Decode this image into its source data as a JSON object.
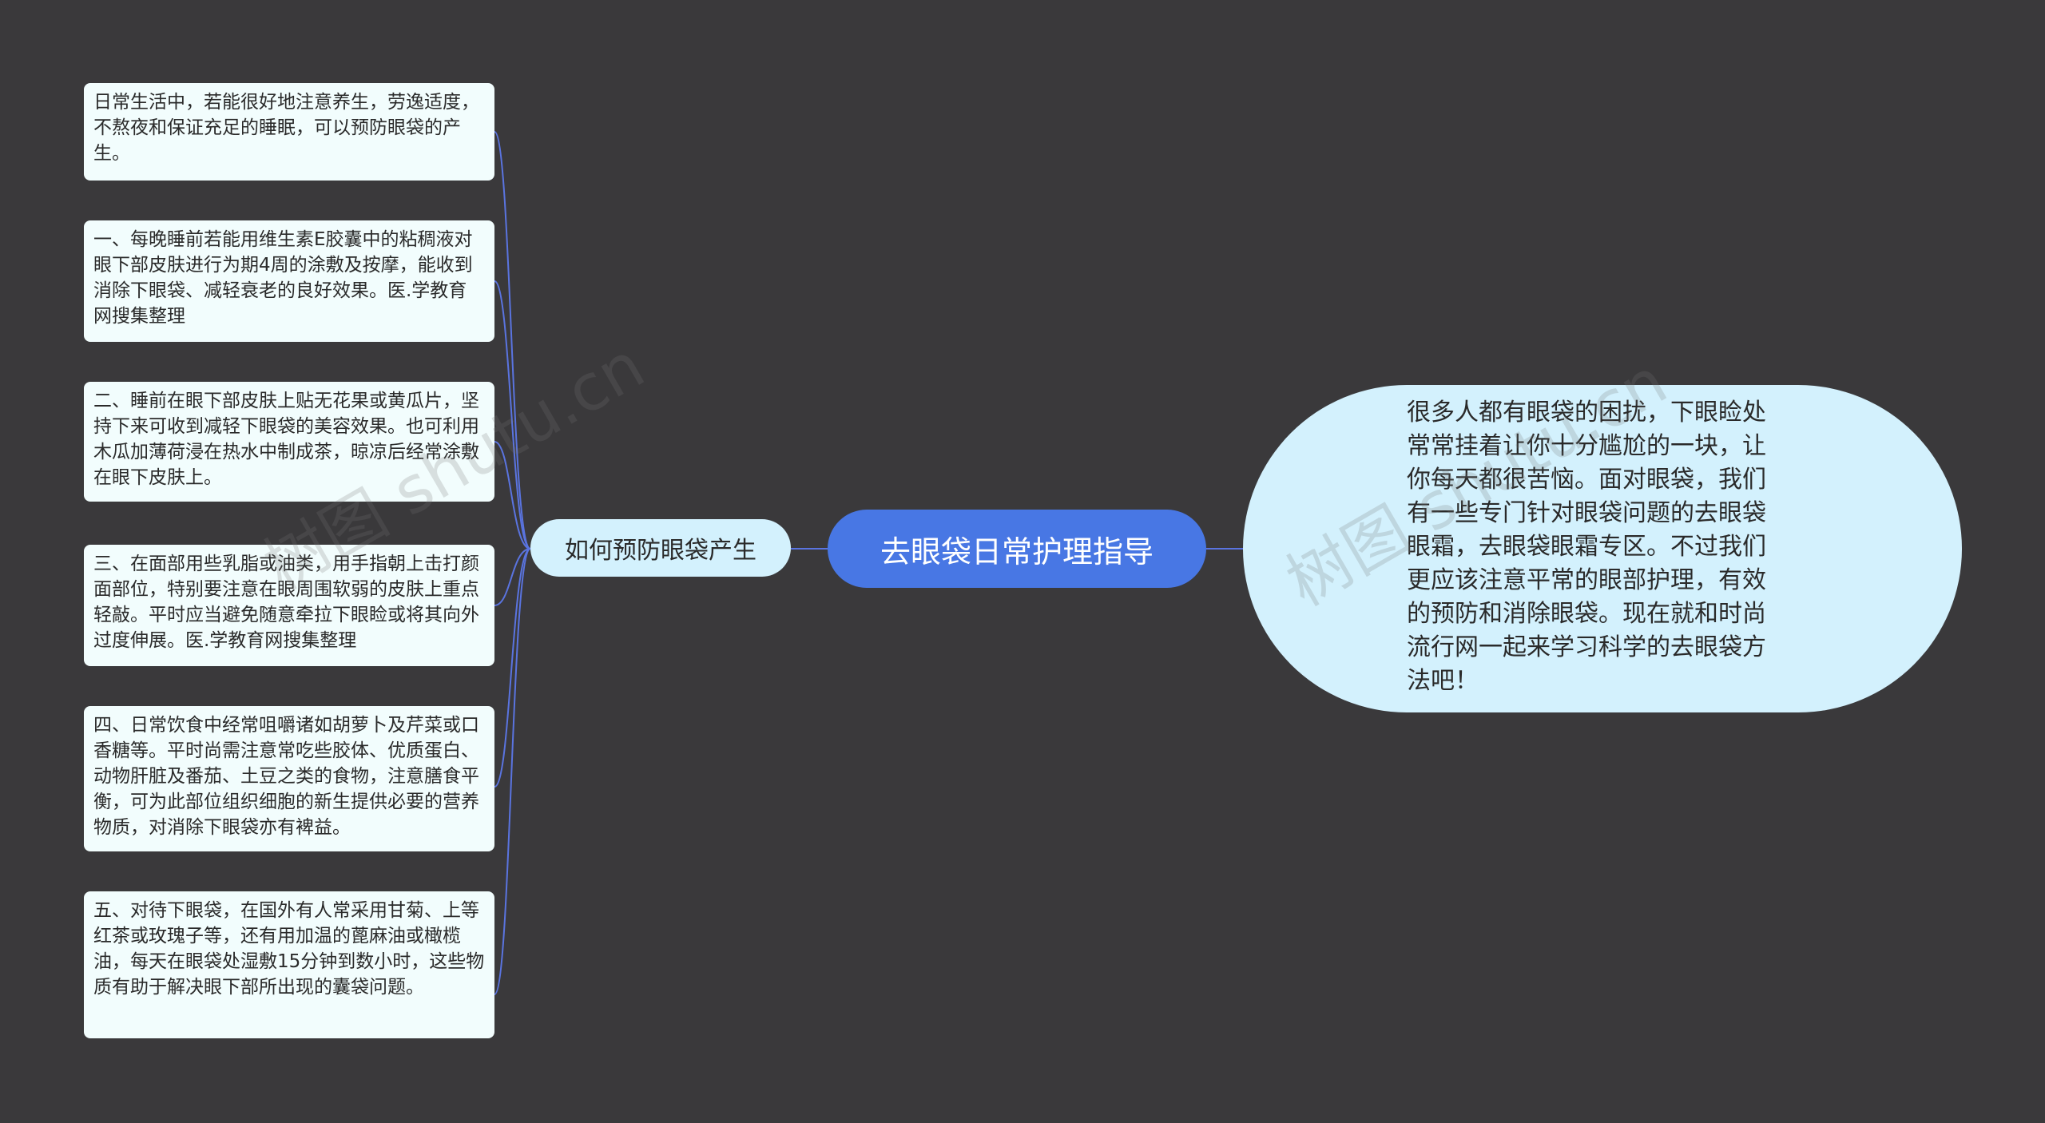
{
  "root": {
    "label": "去眼袋日常护理指导"
  },
  "branch": {
    "label": "如何预防眼袋产生"
  },
  "intro": {
    "text": "很多人都有眼袋的困扰，下眼睑处常常挂着让你十分尴尬的一块，让你每天都很苦恼。面对眼袋，我们有一些专门针对眼袋问题的去眼袋眼霜，去眼袋眼霜专区。不过我们更应该注意平常的眼部护理，有效的预防和消除眼袋。现在就和时尚流行网一起来学习科学的去眼袋方法吧！"
  },
  "leaves": [
    {
      "text": "日常生活中，若能很好地注意养生，劳逸适度，不熬夜和保证充足的睡眠，可以预防眼袋的产生。"
    },
    {
      "text": "一、每晚睡前若能用维生素E胶囊中的粘稠液对眼下部皮肤进行为期4周的涂敷及按摩，能收到消除下眼袋、减轻衰老的良好效果。医.学教育网搜集整理"
    },
    {
      "text": "二、睡前在眼下部皮肤上贴无花果或黄瓜片，坚持下来可收到减轻下眼袋的美容效果。也可利用木瓜加薄荷浸在热水中制成茶，晾凉后经常涂敷在眼下皮肤上。"
    },
    {
      "text": "三、在面部用些乳脂或油类，用手指朝上击打颜面部位，特别要注意在眼周围软弱的皮肤上重点轻敲。平时应当避免随意牵拉下眼睑或将其向外过度伸展。医.学教育网搜集整理"
    },
    {
      "text": "四、日常饮食中经常咀嚼诸如胡萝卜及芹菜或口香糖等。平时尚需注意常吃些胶体、优质蛋白、动物肝脏及番茄、土豆之类的食物，注意膳食平衡，可为此部位组织细胞的新生提供必要的营养物质，对消除下眼袋亦有裨益。"
    },
    {
      "text": "五、对待下眼袋，在国外有人常采用甘菊、上等红茶或玫瑰子等，还有用加温的蓖麻油或橄榄油，每天在眼袋处湿敷15分钟到数小时，这些物质有助于解决眼下部所出现的囊袋问题。"
    }
  ],
  "watermark": {
    "text": "树图 shutu.cn"
  },
  "colors": {
    "background": "#3a393b",
    "root": "#4877e4",
    "bubble": "#d3f1fd",
    "leaf": "#f2fdfd",
    "connector": "#5a74e0"
  }
}
